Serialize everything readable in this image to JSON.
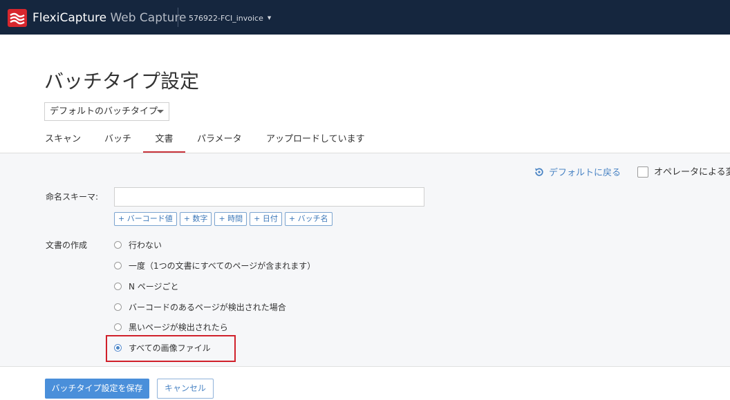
{
  "header": {
    "brand_primary": "FlexiCapture",
    "brand_secondary": "Web Capture",
    "project_name": "576922-FCI_invoice",
    "logo_icon": "flexicapture-logo-icon"
  },
  "page": {
    "title": "バッチタイプ設定",
    "batch_type_selected": "デフォルトのバッチタイプ"
  },
  "tabs": [
    {
      "label": "スキャン",
      "active": false
    },
    {
      "label": "バッチ",
      "active": false
    },
    {
      "label": "文書",
      "active": true
    },
    {
      "label": "パラメータ",
      "active": false
    },
    {
      "label": "アップロードしています",
      "active": false
    }
  ],
  "toolbar": {
    "reset_label": "デフォルトに戻る",
    "operator_change_label": "オペレータによる変"
  },
  "naming": {
    "label": "命名スキーマ:",
    "value": "",
    "tokens": [
      "+ バーコード値",
      "+ 数字",
      "+ 時間",
      "+ 日付",
      "+ バッチ名"
    ]
  },
  "document_creation": {
    "label": "文書の作成",
    "options": [
      {
        "label": "行わない",
        "checked": false
      },
      {
        "label": "一度（1つの文書にすべてのページが含まれます）",
        "checked": false
      },
      {
        "label": "N ページごと",
        "checked": false
      },
      {
        "label": "バーコードのあるページが検出された場合",
        "checked": false
      },
      {
        "label": "黒いページが検出されたら",
        "checked": false
      },
      {
        "label": "すべての画像ファイル",
        "checked": true
      }
    ]
  },
  "footer": {
    "save_label": "バッチタイプ設定を保存",
    "cancel_label": "キャンセル"
  },
  "colors": {
    "header_bg": "#15263e",
    "accent_red": "#c8323b",
    "link_blue": "#4a84c4",
    "primary_button": "#4a8fda"
  }
}
